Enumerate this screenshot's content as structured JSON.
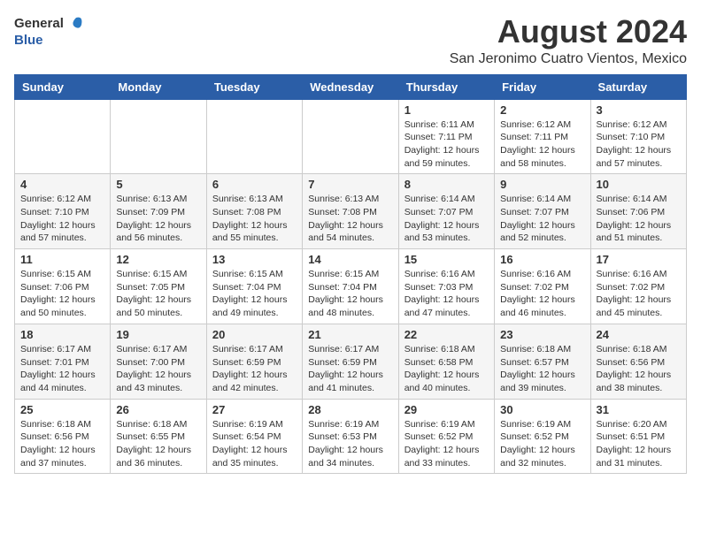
{
  "header": {
    "logo_general": "General",
    "logo_blue": "Blue",
    "title": "August 2024",
    "subtitle": "San Jeronimo Cuatro Vientos, Mexico"
  },
  "days_of_week": [
    "Sunday",
    "Monday",
    "Tuesday",
    "Wednesday",
    "Thursday",
    "Friday",
    "Saturday"
  ],
  "weeks": [
    [
      {
        "day": "",
        "info": ""
      },
      {
        "day": "",
        "info": ""
      },
      {
        "day": "",
        "info": ""
      },
      {
        "day": "",
        "info": ""
      },
      {
        "day": "1",
        "info": "Sunrise: 6:11 AM\nSunset: 7:11 PM\nDaylight: 12 hours and 59 minutes."
      },
      {
        "day": "2",
        "info": "Sunrise: 6:12 AM\nSunset: 7:11 PM\nDaylight: 12 hours and 58 minutes."
      },
      {
        "day": "3",
        "info": "Sunrise: 6:12 AM\nSunset: 7:10 PM\nDaylight: 12 hours and 57 minutes."
      }
    ],
    [
      {
        "day": "4",
        "info": "Sunrise: 6:12 AM\nSunset: 7:10 PM\nDaylight: 12 hours and 57 minutes."
      },
      {
        "day": "5",
        "info": "Sunrise: 6:13 AM\nSunset: 7:09 PM\nDaylight: 12 hours and 56 minutes."
      },
      {
        "day": "6",
        "info": "Sunrise: 6:13 AM\nSunset: 7:08 PM\nDaylight: 12 hours and 55 minutes."
      },
      {
        "day": "7",
        "info": "Sunrise: 6:13 AM\nSunset: 7:08 PM\nDaylight: 12 hours and 54 minutes."
      },
      {
        "day": "8",
        "info": "Sunrise: 6:14 AM\nSunset: 7:07 PM\nDaylight: 12 hours and 53 minutes."
      },
      {
        "day": "9",
        "info": "Sunrise: 6:14 AM\nSunset: 7:07 PM\nDaylight: 12 hours and 52 minutes."
      },
      {
        "day": "10",
        "info": "Sunrise: 6:14 AM\nSunset: 7:06 PM\nDaylight: 12 hours and 51 minutes."
      }
    ],
    [
      {
        "day": "11",
        "info": "Sunrise: 6:15 AM\nSunset: 7:06 PM\nDaylight: 12 hours and 50 minutes."
      },
      {
        "day": "12",
        "info": "Sunrise: 6:15 AM\nSunset: 7:05 PM\nDaylight: 12 hours and 50 minutes."
      },
      {
        "day": "13",
        "info": "Sunrise: 6:15 AM\nSunset: 7:04 PM\nDaylight: 12 hours and 49 minutes."
      },
      {
        "day": "14",
        "info": "Sunrise: 6:15 AM\nSunset: 7:04 PM\nDaylight: 12 hours and 48 minutes."
      },
      {
        "day": "15",
        "info": "Sunrise: 6:16 AM\nSunset: 7:03 PM\nDaylight: 12 hours and 47 minutes."
      },
      {
        "day": "16",
        "info": "Sunrise: 6:16 AM\nSunset: 7:02 PM\nDaylight: 12 hours and 46 minutes."
      },
      {
        "day": "17",
        "info": "Sunrise: 6:16 AM\nSunset: 7:02 PM\nDaylight: 12 hours and 45 minutes."
      }
    ],
    [
      {
        "day": "18",
        "info": "Sunrise: 6:17 AM\nSunset: 7:01 PM\nDaylight: 12 hours and 44 minutes."
      },
      {
        "day": "19",
        "info": "Sunrise: 6:17 AM\nSunset: 7:00 PM\nDaylight: 12 hours and 43 minutes."
      },
      {
        "day": "20",
        "info": "Sunrise: 6:17 AM\nSunset: 6:59 PM\nDaylight: 12 hours and 42 minutes."
      },
      {
        "day": "21",
        "info": "Sunrise: 6:17 AM\nSunset: 6:59 PM\nDaylight: 12 hours and 41 minutes."
      },
      {
        "day": "22",
        "info": "Sunrise: 6:18 AM\nSunset: 6:58 PM\nDaylight: 12 hours and 40 minutes."
      },
      {
        "day": "23",
        "info": "Sunrise: 6:18 AM\nSunset: 6:57 PM\nDaylight: 12 hours and 39 minutes."
      },
      {
        "day": "24",
        "info": "Sunrise: 6:18 AM\nSunset: 6:56 PM\nDaylight: 12 hours and 38 minutes."
      }
    ],
    [
      {
        "day": "25",
        "info": "Sunrise: 6:18 AM\nSunset: 6:56 PM\nDaylight: 12 hours and 37 minutes."
      },
      {
        "day": "26",
        "info": "Sunrise: 6:18 AM\nSunset: 6:55 PM\nDaylight: 12 hours and 36 minutes."
      },
      {
        "day": "27",
        "info": "Sunrise: 6:19 AM\nSunset: 6:54 PM\nDaylight: 12 hours and 35 minutes."
      },
      {
        "day": "28",
        "info": "Sunrise: 6:19 AM\nSunset: 6:53 PM\nDaylight: 12 hours and 34 minutes."
      },
      {
        "day": "29",
        "info": "Sunrise: 6:19 AM\nSunset: 6:52 PM\nDaylight: 12 hours and 33 minutes."
      },
      {
        "day": "30",
        "info": "Sunrise: 6:19 AM\nSunset: 6:52 PM\nDaylight: 12 hours and 32 minutes."
      },
      {
        "day": "31",
        "info": "Sunrise: 6:20 AM\nSunset: 6:51 PM\nDaylight: 12 hours and 31 minutes."
      }
    ]
  ]
}
